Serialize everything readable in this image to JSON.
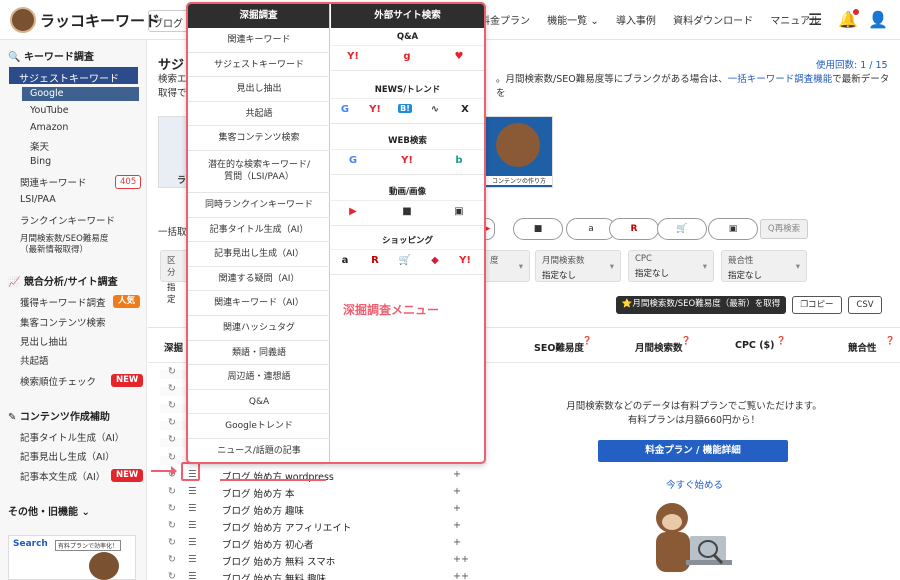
{
  "header": {
    "logo_text": "ラッコキーワード",
    "search_value": "ブログ 始",
    "nav": [
      "料金プラン",
      "機能一覧 ⌄",
      "導入事例",
      "資料ダウンロード",
      "マニュアル"
    ],
    "icons": [
      "menu-icon",
      "bell-icon",
      "user-icon"
    ],
    "colors": {
      "accent": "#2c4b8b",
      "red": "#e4262c",
      "highlight": "#ef5f71"
    }
  },
  "sidebar": {
    "keyword_section": "キーワード調査",
    "active_item": "サジェストキーワード",
    "sub_items": [
      "Google",
      "YouTube",
      "Amazon",
      "楽天",
      "Bing"
    ],
    "items": [
      "関連キーワード",
      "LSI/PAA",
      "ランクインキーワード",
      "月間検索数/SEO難易度",
      "（最新情報取得）"
    ],
    "related_badge": "405",
    "competitor_section": "競合分析/サイト調査",
    "competitor_items": [
      "獲得キーワード調査",
      "集客コンテンツ検索",
      "見出し抽出",
      "共起語",
      "検索順位チェック"
    ],
    "hot_badge": "人気",
    "new_badge": "NEW",
    "content_section": "コンテンツ作成補助",
    "content_items": [
      "記事タイトル生成（AI）",
      "記事見出し生成（AI）",
      "記事本文生成（AI）"
    ],
    "other_section": "その他・旧機能 ⌄",
    "banner_text": "Search",
    "banner_tag": "有料プランで効率化！"
  },
  "main": {
    "title": "サジ",
    "usage": "使用回数: 1 / 15",
    "desc_left": "検索エ",
    "desc_mid": "。月間検索数/SEO難易度等にブランクがある場合は、",
    "desc_link": "一括キーワード調査機能",
    "desc_tail": "で最新データを",
    "desc_line2": "取得で",
    "thumb_caption_left": "ラ",
    "thumb_caption_right": "コンテンツの作り方",
    "bulk_label": "一括取",
    "btn_labels": [
      "▶",
      "■",
      "a",
      "R",
      "🛒",
      "▣"
    ],
    "research_label": "Q再検索",
    "filters": [
      {
        "label": "区分",
        "value": "指定"
      },
      {
        "label": "度",
        "value": ""
      },
      {
        "label": "月間検索数",
        "value": "指定なし"
      },
      {
        "label": "CPC",
        "value": "指定なし"
      },
      {
        "label": "競合性",
        "value": "指定なし"
      }
    ],
    "fetch_button": "⭐月間検索数/SEO難易度（最新）を取得",
    "copy_button": "コピー",
    "csv_button": "CSV",
    "col_headers": [
      "深掘",
      "SEO難易度",
      "月間検索数",
      "CPC ($)",
      "競合性"
    ],
    "rows": [
      {
        "icon": "↻",
        "hb": "☰",
        "kw": "",
        "plus": ""
      },
      {
        "icon": "↻",
        "hb": "☰",
        "kw": "",
        "plus": ""
      },
      {
        "icon": "↻",
        "hb": "☰",
        "kw": "",
        "plus": ""
      },
      {
        "icon": "↻",
        "hb": "☰",
        "kw": "",
        "plus": ""
      },
      {
        "icon": "↻",
        "hb": "☰",
        "kw": "",
        "plus": ""
      },
      {
        "icon": "↻",
        "hb": "☰",
        "kw": "",
        "plus": ""
      },
      {
        "icon": "↻",
        "hb": "☰",
        "kw": "ブログ 始め方 wordpress",
        "plus": "+"
      },
      {
        "icon": "↻",
        "hb": "☰",
        "kw": "ブログ 始め方 本",
        "plus": "+"
      },
      {
        "icon": "↻",
        "hb": "☰",
        "kw": "ブログ 始め方 趣味",
        "plus": "+"
      },
      {
        "icon": "↻",
        "hb": "☰",
        "kw": "ブログ 始め方 アフィリエイト",
        "plus": "+"
      },
      {
        "icon": "↻",
        "hb": "☰",
        "kw": "ブログ 始め方 初心者",
        "plus": "+"
      },
      {
        "icon": "↻",
        "hb": "☰",
        "kw": "ブログ 始め方 無料 スマホ",
        "plus": "++"
      },
      {
        "icon": "↻",
        "hb": "☰",
        "kw": "ブログ 始め方 無料 趣味",
        "plus": "++"
      }
    ],
    "upsell_line1": "月間検索数などのデータは有料プランでご覧いただけます。",
    "upsell_line2": "有料プランは月額660円から！",
    "upsell_button": "料金プラン / 機能詳細",
    "start_link": "今すぐ始める"
  },
  "popup": {
    "left_header": "深掘調査",
    "left_items": [
      "関連キーワード",
      "サジェストキーワード",
      "見出し抽出",
      "共起語",
      "集客コンテンツ検索",
      "潜在的な検索キーワード/",
      "質問（LSI/PAA）",
      "同時ランクインキーワード",
      "記事タイトル生成（AI）",
      "記事見出し生成（AI）",
      "関連する疑問（AI）",
      "関連キーワード（AI）",
      "関連ハッシュタグ",
      "類語・同義語",
      "周辺語・連想語",
      "Q&A",
      "Googleトレンド",
      "ニュース/話題の記事"
    ],
    "right_header": "外部サイト検索",
    "sections": [
      "Q&A",
      "NEWS/トレンド",
      "WEB検索",
      "動画/画像",
      "ショッピング"
    ],
    "qa_icons": [
      "Y!",
      "g",
      "♥"
    ],
    "news_icons": [
      "G",
      "Y!",
      "B!",
      "∿",
      "X"
    ],
    "web_icons": [
      "G",
      "Y!",
      "b"
    ],
    "media_icons": [
      "▶",
      "■",
      "▣"
    ],
    "shop_icons": [
      "a",
      "R",
      "🛒",
      "◆",
      "Y!"
    ],
    "menu_label": "深掘調査メニュー"
  }
}
